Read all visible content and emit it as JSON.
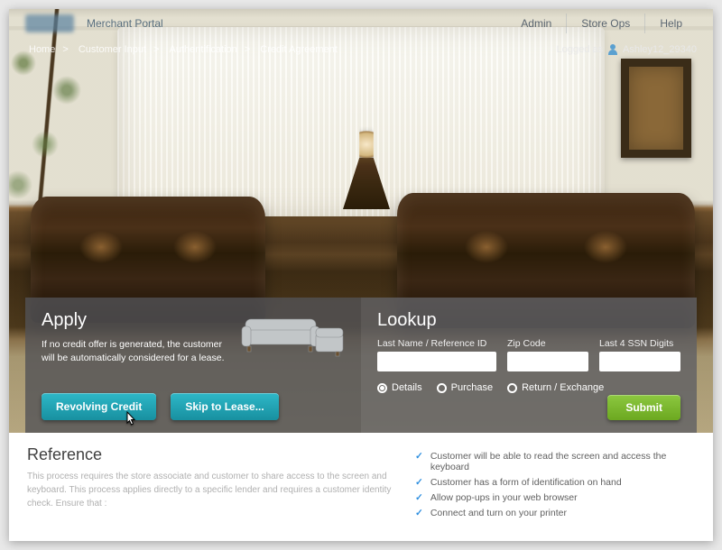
{
  "header": {
    "portal_title": "Merchant Portal",
    "nav": [
      "Admin",
      "Store Ops",
      "Help"
    ]
  },
  "subheader": {
    "breadcrumb": [
      "Home",
      "Customer Input",
      "Authentification",
      "Credit Agreement"
    ],
    "logged_label": "Logged as",
    "username": "Ashley12_29340"
  },
  "apply": {
    "title": "Apply",
    "desc": "If no credit offer is generated, the customer will be automatically considered for a lease.",
    "btn_revolving": "Revolving Credit",
    "btn_skip": "Skip to Lease..."
  },
  "lookup": {
    "title": "Lookup",
    "fields": {
      "lastname_label": "Last Name / Reference ID",
      "zip_label": "Zip Code",
      "ssn_label": "Last 4 SSN Digits"
    },
    "radios": {
      "details": "Details",
      "purchase": "Purchase",
      "return": "Return / Exchange"
    },
    "submit": "Submit"
  },
  "reference": {
    "title": "Reference",
    "desc": "This process requires the store associate and customer to share access to the screen and keyboard. This process applies directly to a specific lender and requires a customer identity check. Ensure that :",
    "checks": [
      "Customer will be able to read the screen and access the keyboard",
      "Customer has a form of identification on hand",
      "Allow pop-ups in your web browser",
      "Connect and turn on your printer"
    ]
  }
}
